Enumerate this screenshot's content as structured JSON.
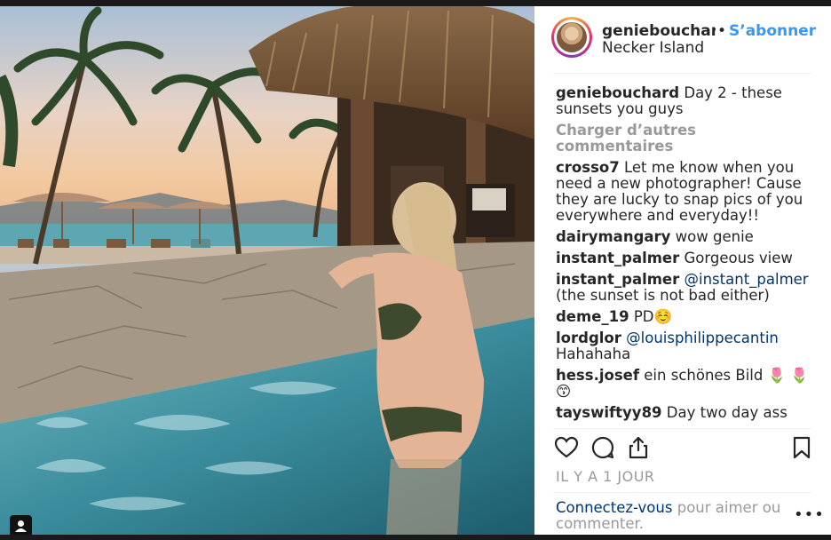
{
  "post": {
    "username": "geniebouchard",
    "follow_label": "S’abonner",
    "dot": "•",
    "location": "Necker Island",
    "caption": {
      "user": "geniebouchard",
      "text": "Day 2 - these sunsets you guys"
    },
    "load_more_label": "Charger d’autres commentaires",
    "comments": [
      {
        "user": "crosso7",
        "text": "Let me know when you need a new photographer! Cause they are lucky to snap pics of you everywhere and everyday!!"
      },
      {
        "user": "dairymangary",
        "text": "wow genie"
      },
      {
        "user": "instant_palmer",
        "text": "Gorgeous view"
      },
      {
        "user": "instant_palmer",
        "mention": "@instant_palmer",
        "text": "(the sunset is not bad either)"
      },
      {
        "user": "deme_19",
        "text": "PD☺️"
      },
      {
        "user": "lordglor",
        "mention": "@louisphilippecantin",
        "text": "Hahahaha"
      },
      {
        "user": "hess.josef",
        "text": "ein schönes Bild 🌷 🌷 😙"
      },
      {
        "user": "tayswiftyy89",
        "text": "Day two day ass"
      }
    ],
    "timestamp": "IL Y A 1 JOUR",
    "login_prompt": {
      "link": "Connectez-vous",
      "text": "pour aimer ou commenter."
    },
    "more_label": "•••"
  },
  "icons": {
    "like": "heart-icon",
    "comment": "comment-icon",
    "share": "share-icon",
    "save": "bookmark-icon",
    "user_tag": "user-tag-icon"
  },
  "colors": {
    "link_blue": "#3897f0",
    "mention_blue": "#003569",
    "muted_gray": "#999999",
    "text": "#262626"
  }
}
